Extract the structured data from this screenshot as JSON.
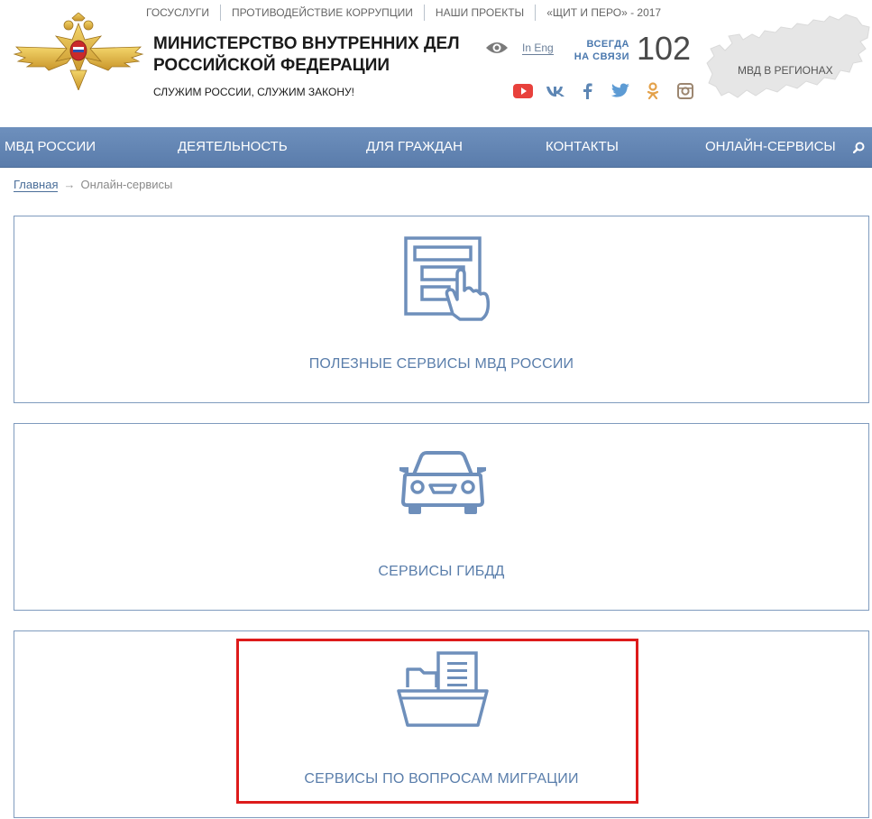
{
  "header": {
    "top_links": [
      "ГОСУСЛУГИ",
      "ПРОТИВОДЕЙСТВИЕ КОРРУПЦИИ",
      "НАШИ ПРОЕКТЫ",
      "«ЩИТ И ПЕРО» - 2017"
    ],
    "title": "МИНИСТЕРСТВО ВНУТРЕННИХ ДЕЛ РОССИЙСКОЙ ФЕДЕРАЦИИ",
    "slogan": "СЛУЖИМ РОССИИ, СЛУЖИМ ЗАКОНУ!",
    "lang_link": "In Eng",
    "always_line1": "ВСЕГДА",
    "always_line2": "НА СВЯЗИ",
    "phone": "102",
    "regions_label": "МВД В РЕГИОНАХ",
    "socials": [
      "youtube-icon",
      "vk-icon",
      "facebook-icon",
      "twitter-icon",
      "odnoklassniki-icon",
      "instagram-icon"
    ]
  },
  "nav": {
    "items": [
      "МВД РОССИИ",
      "ДЕЯТЕЛЬНОСТЬ",
      "ДЛЯ ГРАЖДАН",
      "КОНТАКТЫ",
      "ОНЛАЙН-СЕРВИСЫ"
    ]
  },
  "breadcrumb": {
    "home": "Главная",
    "separator": "→",
    "current": "Онлайн-сервисы"
  },
  "cards": [
    {
      "label": "ПОЛЕЗНЫЕ СЕРВИСЫ МВД РОССИИ",
      "icon": "touch-form-icon"
    },
    {
      "label": "СЕРВИСЫ ГИБДД",
      "icon": "car-icon"
    },
    {
      "label": "СЕРВИСЫ ПО ВОПРОСАМ МИГРАЦИИ",
      "icon": "folder-document-icon"
    }
  ],
  "colors": {
    "nav_bg": "#6283b3",
    "accent_blue": "#5a7eab",
    "card_border": "#7f9bbe",
    "highlight_red": "#dd1b1b"
  }
}
